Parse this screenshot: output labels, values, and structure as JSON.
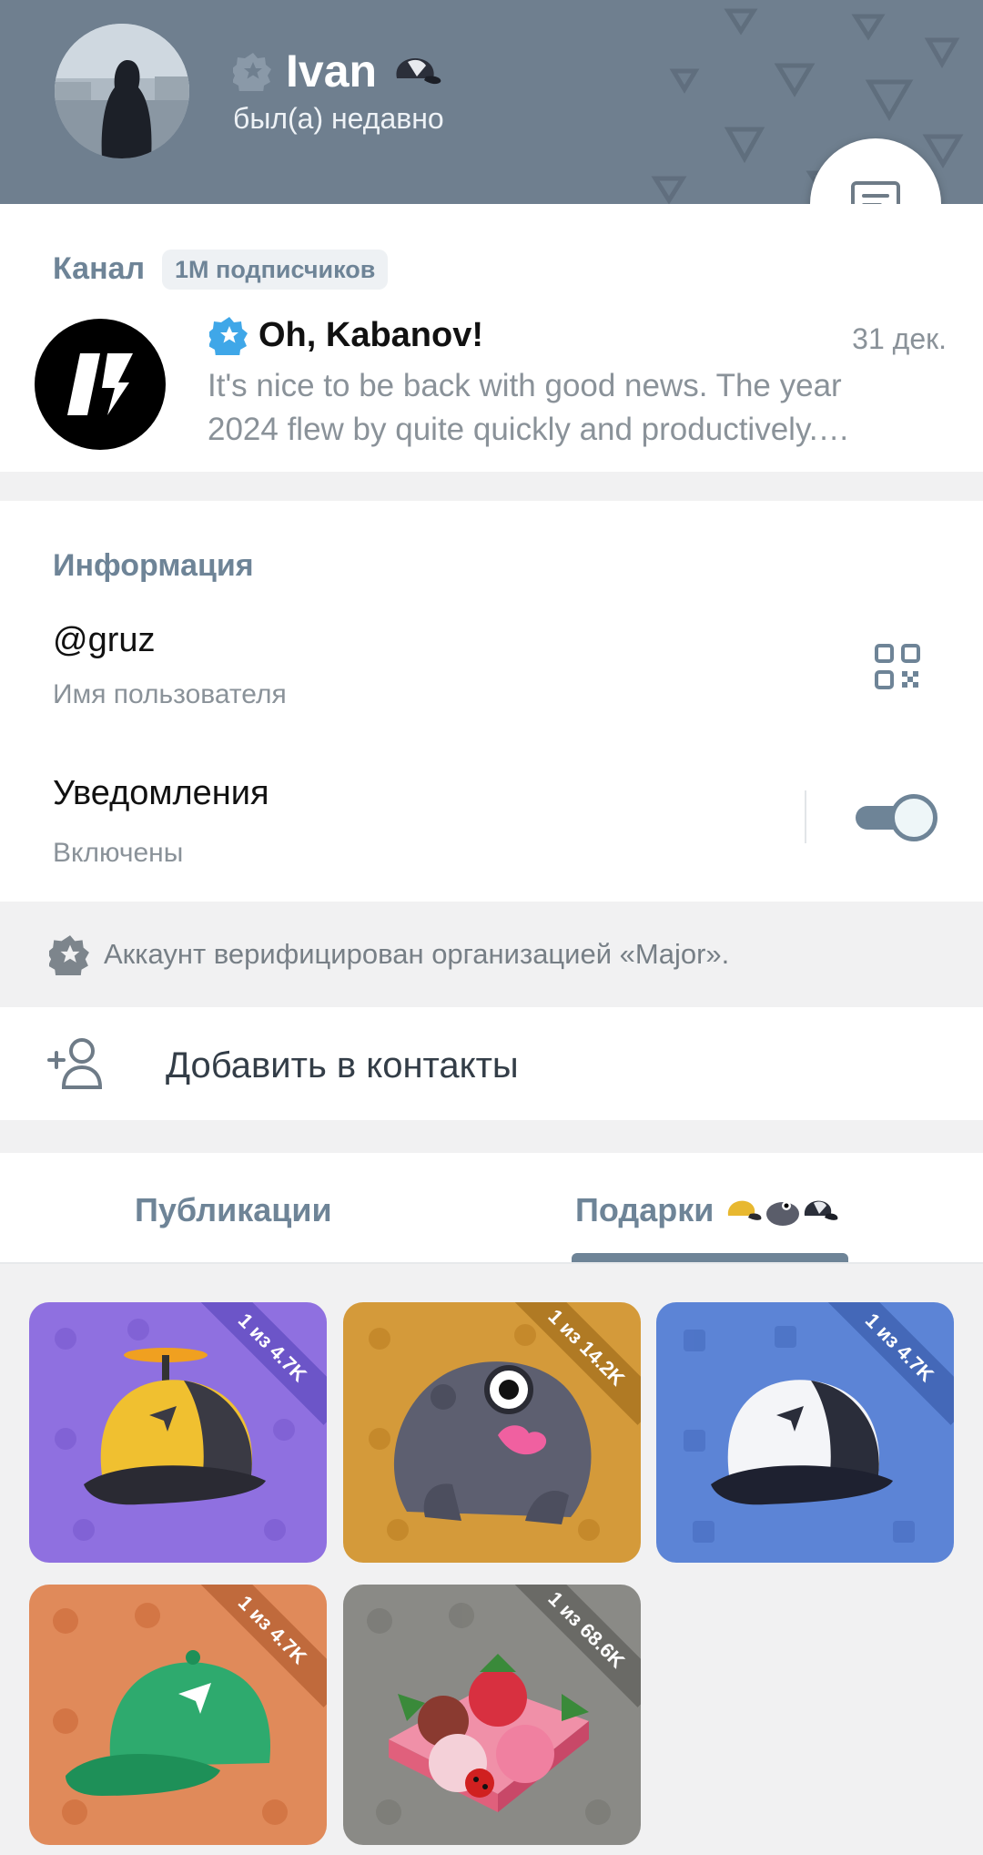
{
  "header": {
    "name": "Ivan",
    "status": "был(а) недавно",
    "bg_color": "#6f7f8f"
  },
  "channel": {
    "section_label": "Канал",
    "subscribers": "1M подписчиков",
    "title": "Oh, Kabanov!",
    "date": "31 дек.",
    "preview_line1": "It's nice to be back with good news. The year",
    "preview_line2": "2024 flew by quite quickly and productively.…"
  },
  "info": {
    "section_label": "Информация",
    "username": "@gruz",
    "username_label": "Имя пользователя",
    "notifications_title": "Уведомления",
    "notifications_state": "Включены",
    "notifications_enabled": true
  },
  "verification": {
    "text": "Аккаунт верифицирован организацией «Major»."
  },
  "contacts": {
    "add_label": "Добавить в контакты"
  },
  "tabs": {
    "publications": "Публикации",
    "gifts": "Подарки"
  },
  "gifts": [
    {
      "badge": "1 из 4.7K",
      "icon": "propeller-cap-icon",
      "bg": "#8f70e0",
      "ribbon": "#6c55c8"
    },
    {
      "badge": "1 из 14.2K",
      "icon": "frog-icon",
      "bg": "#d49a3a",
      "ribbon": "#b07a24"
    },
    {
      "badge": "1 из 4.7K",
      "icon": "white-cap-icon",
      "bg": "#5c84d6",
      "ribbon": "#4468b8"
    },
    {
      "badge": "1 из 4.7K",
      "icon": "green-cap-icon",
      "bg": "#e08a5a",
      "ribbon": "#c06a3c"
    },
    {
      "badge": "1 из 68.6K",
      "icon": "strawberry-box-icon",
      "bg": "#8a8a86",
      "ribbon": "#6a6a66"
    }
  ]
}
